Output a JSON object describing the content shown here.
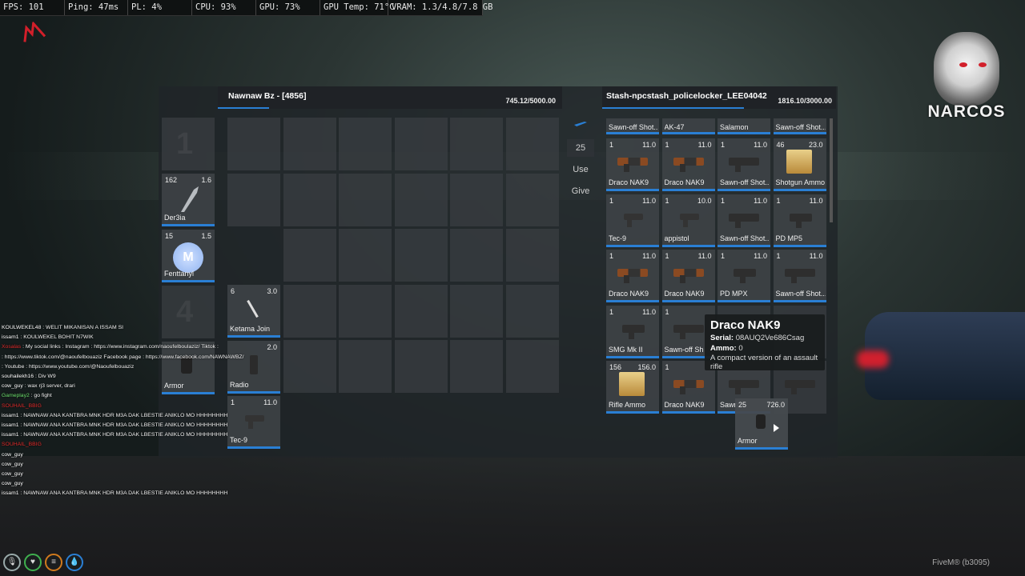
{
  "perf": [
    "FPS: 101",
    "Ping: 47ms",
    "PL: 4%",
    "CPU: 93%",
    "GPU: 73%",
    "GPU Temp: 71°C",
    "VRAM: 1.3/4.8/7.8 GB"
  ],
  "brand": {
    "name": "NARCOS"
  },
  "player_inventory": {
    "title": "Nawnaw Bz - [4856]",
    "weight": "745.12/5000.00",
    "weight_fill": 0.149
  },
  "stash_inventory": {
    "title": "Stash-npcstash_policelocker_LEE04042",
    "weight": "1816.10/3000.00",
    "weight_fill": 0.605
  },
  "hotbar": [
    {
      "number": "1",
      "empty": true
    },
    {
      "qty": "162",
      "weight": "1.6",
      "label": "Der3ia",
      "icon": "shield-icon"
    },
    {
      "qty": "15",
      "weight": "1.5",
      "label": "Fenttanyl",
      "icon": "pill-icon"
    },
    {
      "number": "4",
      "empty": true
    },
    {
      "qty": "",
      "weight": "",
      "label": "Armor",
      "icon": "armor-icon"
    }
  ],
  "player_slots": [
    {
      "qty": "6",
      "weight": "3.0",
      "label": "Ketama Join",
      "icon": "joint-icon"
    },
    {
      "qty": "",
      "weight": "2.0",
      "label": "Radio",
      "icon": "radio-icon"
    },
    {
      "qty": "1",
      "weight": "11.0",
      "label": "Tec-9",
      "icon": "pistol-icon"
    }
  ],
  "actions": {
    "amount": "25",
    "use": "Use",
    "give": "Give"
  },
  "stash_items": [
    {
      "qty": "",
      "weight": "",
      "label": "Sawn-off Shot...",
      "icon": "shotgun-icon"
    },
    {
      "qty": "",
      "weight": "",
      "label": "AK-47",
      "icon": "rifle-icon"
    },
    {
      "qty": "",
      "weight": "",
      "label": "Salamon",
      "icon": "knife-icon"
    },
    {
      "qty": "",
      "weight": "",
      "label": "Sawn-off Shot...",
      "icon": "shotgun-icon"
    },
    {
      "qty": "1",
      "weight": "11.0",
      "label": "Draco NAK9",
      "icon": "rifle-icon"
    },
    {
      "qty": "1",
      "weight": "11.0",
      "label": "Draco NAK9",
      "icon": "rifle-icon"
    },
    {
      "qty": "1",
      "weight": "11.0",
      "label": "Sawn-off Shot...",
      "icon": "shotgun-icon"
    },
    {
      "qty": "46",
      "weight": "23.0",
      "label": "Shotgun Ammo",
      "icon": "ammo-box-icon"
    },
    {
      "qty": "1",
      "weight": "11.0",
      "label": "Tec-9",
      "icon": "pistol-icon"
    },
    {
      "qty": "1",
      "weight": "10.0",
      "label": "appistol",
      "icon": "pistol-icon"
    },
    {
      "qty": "1",
      "weight": "11.0",
      "label": "Sawn-off Shot...",
      "icon": "shotgun-icon"
    },
    {
      "qty": "1",
      "weight": "11.0",
      "label": "PD MP5",
      "icon": "smg-icon"
    },
    {
      "qty": "1",
      "weight": "11.0",
      "label": "Draco NAK9",
      "icon": "rifle-icon"
    },
    {
      "qty": "1",
      "weight": "11.0",
      "label": "Draco NAK9",
      "icon": "rifle-icon"
    },
    {
      "qty": "1",
      "weight": "11.0",
      "label": "PD MPX",
      "icon": "smg-icon"
    },
    {
      "qty": "1",
      "weight": "11.0",
      "label": "Sawn-off Shot...",
      "icon": "shotgun-icon"
    },
    {
      "qty": "1",
      "weight": "11.0",
      "label": "SMG Mk II",
      "icon": "smg-icon"
    },
    {
      "qty": "1",
      "weight": "",
      "label": "Sawn-off Sh",
      "icon": "shotgun-icon"
    },
    {
      "qty": "",
      "weight": "",
      "label": "",
      "icon": ""
    },
    {
      "qty": "",
      "weight": "",
      "label": "",
      "icon": ""
    },
    {
      "qty": "156",
      "weight": "156.0",
      "label": "Rifle Ammo",
      "icon": "ammo-box-icon"
    },
    {
      "qty": "1",
      "weight": "",
      "label": "Draco NAK9",
      "icon": "rifle-icon"
    },
    {
      "qty": "",
      "weight": "",
      "label": "Sawn",
      "icon": "shotgun-icon"
    },
    {
      "qty": "",
      "weight": "",
      "label": "",
      "icon": "shotgun-icon"
    }
  ],
  "dragging": {
    "qty": "25",
    "weight": "726.0",
    "label": "Armor"
  },
  "tooltip": {
    "name": "Draco NAK9",
    "serial_label": "Serial:",
    "serial": "08AUQ2Ve686Csag",
    "ammo_label": "Ammo:",
    "ammo": "0",
    "description": "A compact version of an assault rifle"
  },
  "chat": [
    {
      "name": "KOULWEKEL48",
      "text": "WELIT MIKANISAN A ISSAM SI",
      "color": "white"
    },
    {
      "name": "issam1",
      "text": "KOULWEKEL BOHIT N7WIK",
      "color": "white"
    },
    {
      "name": "Xosalas",
      "text": "My social links : Instagram : https://www.instagram.com/naoufelboulaziz/ Tiktok :",
      "color": "red"
    },
    {
      "name": "",
      "text": "https://www.tiktok.com/@naoufelbouaziz Facebook page : https://www.facebook.com/NAWNAWBZ/",
      "color": "white"
    },
    {
      "name": "",
      "text": "Youtube : https://www.youtube.com/@Naoufelbouaziz",
      "color": "white"
    },
    {
      "name": "souhailekh16",
      "text": "Div W9",
      "color": "white"
    },
    {
      "name": "cow_guy",
      "text": "wax rj3 server, drari",
      "color": "white"
    },
    {
      "name": "Gameplay2",
      "text": "go fight",
      "color": "green"
    },
    {
      "name": "SOUHAIL_BBIG",
      "text": "",
      "color": "red"
    },
    {
      "name": "issam1",
      "text": "NAWNAW ANA KANTBRA MNK HDR M3A DAK LBESTIE ANIKLO MO HHHHHHHH",
      "color": "white"
    },
    {
      "name": "issam1",
      "text": "NAWNAW ANA KANTBRA MNK HDR M3A DAK LBESTIE ANIKLO MO HHHHHHHH",
      "color": "white"
    },
    {
      "name": "issam1",
      "text": "NAWNAW ANA KANTBRA MNK HDR M3A DAK LBESTIE ANIKLO MO HHHHHHHH",
      "color": "white"
    },
    {
      "name": "SOUHAIL_BBIG",
      "text": "",
      "color": "red"
    },
    {
      "name": "cow_guy",
      "text": "",
      "color": "white"
    },
    {
      "name": "cow_guy",
      "text": "",
      "color": "white"
    },
    {
      "name": "cow_guy",
      "text": "",
      "color": "white"
    },
    {
      "name": "cow_guy",
      "text": "",
      "color": "white"
    },
    {
      "name": "issam1",
      "text": "NAWNAW ANA KANTBRA MNK HDR M3A DAK LBESTIE ANIKLO MO HHHHHHHH",
      "color": "white"
    }
  ],
  "footer": {
    "client": "FiveM® (b3095)"
  },
  "colors": {
    "accent": "#2a7fd4",
    "panel": "#202428"
  }
}
